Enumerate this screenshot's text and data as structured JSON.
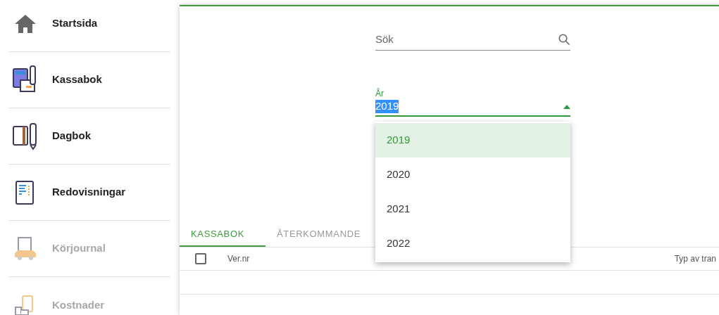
{
  "sidebar": {
    "items": [
      {
        "label": "Startsida",
        "disabled": false
      },
      {
        "label": "Kassabok",
        "disabled": false
      },
      {
        "label": "Dagbok",
        "disabled": false
      },
      {
        "label": "Redovisningar",
        "disabled": false
      },
      {
        "label": "Körjournal",
        "disabled": true
      },
      {
        "label": "Kostnader",
        "disabled": true
      }
    ]
  },
  "search": {
    "placeholder": "Sök"
  },
  "year_select": {
    "label": "År",
    "value": "2019",
    "expanded": true,
    "options": [
      {
        "label": "2019",
        "selected": true
      },
      {
        "label": "2020",
        "selected": false
      },
      {
        "label": "2021",
        "selected": false
      },
      {
        "label": "2022",
        "selected": false
      }
    ]
  },
  "tabs": [
    {
      "label": "KASSABOK",
      "selected": true
    },
    {
      "label": "ÅTERKOMMANDE",
      "selected": false
    }
  ],
  "table": {
    "columns": [
      "Ver.nr",
      "Typ av tran"
    ],
    "select_all_checked": false
  }
}
